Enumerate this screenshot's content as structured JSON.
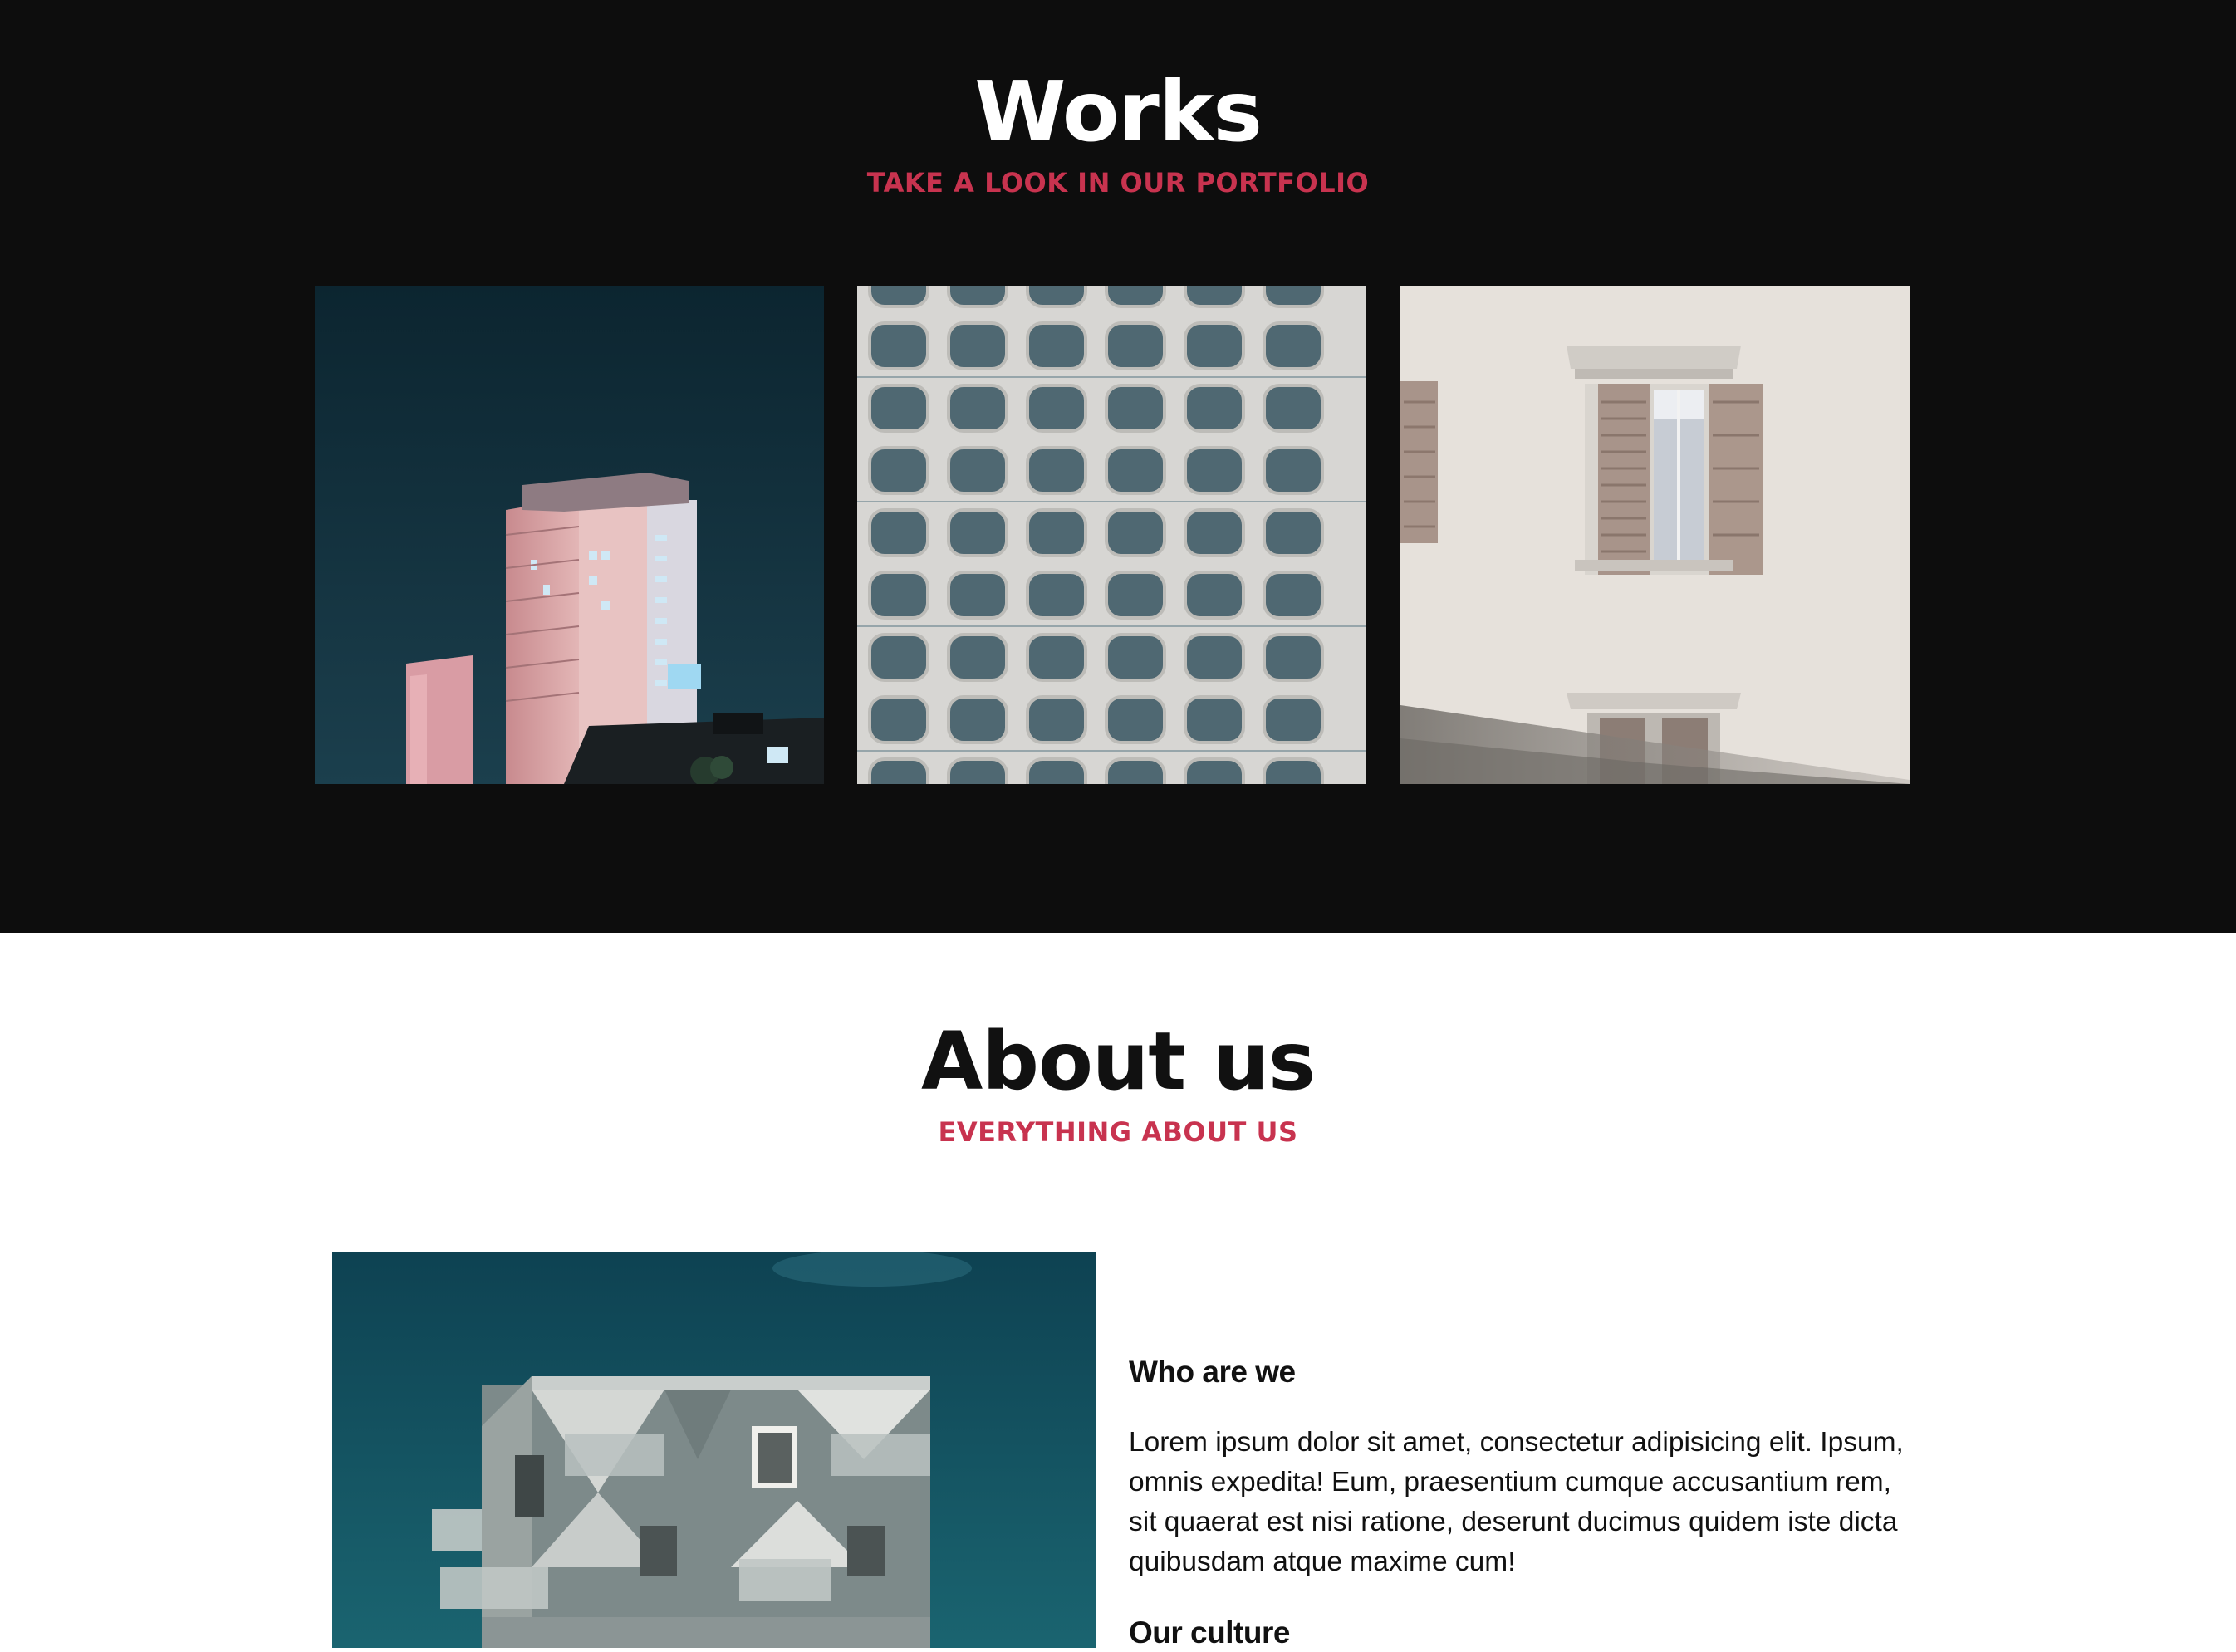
{
  "works": {
    "title": "Works",
    "subtitle": "TAKE A LOOK IN OUR PORTFOLIO",
    "gallery": [
      {
        "icon": "night-tower-building-photo"
      },
      {
        "icon": "rounded-windows-facade-photo"
      },
      {
        "icon": "shuttered-window-wall-photo"
      }
    ]
  },
  "about": {
    "title": "About us",
    "subtitle": "EVERYTHING ABOUT US",
    "image_icon": "cubic-balcony-building-photo",
    "blocks": [
      {
        "heading": "Who are we",
        "text": "Lorem ipsum dolor sit amet, consectetur adipisicing elit. Ipsum, omnis expedita! Eum, praesentium cumque accusantium rem, sit quaerat est nisi ratione, deserunt ducimus quidem iste dicta quibusdam atque maxime cum!"
      },
      {
        "heading": "Our culture"
      }
    ]
  },
  "colors": {
    "dark_background": "#0d0d0d",
    "accent": "#c8334f",
    "light_background": "#ffffff"
  }
}
